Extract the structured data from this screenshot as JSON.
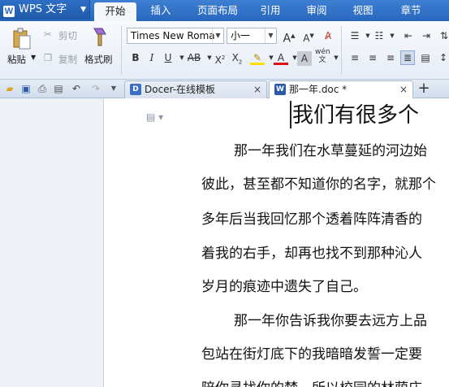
{
  "app": {
    "name": "WPS 文字",
    "logo_letter": "W"
  },
  "menu": [
    "开始",
    "插入",
    "页面布局",
    "引用",
    "审阅",
    "视图",
    "章节"
  ],
  "ribbon": {
    "paste": "粘贴",
    "cut": "剪切",
    "copy": "复制",
    "format_painter": "格式刷",
    "font_name": "Times New Roma",
    "font_size": "小一"
  },
  "tabs": [
    {
      "label": "Docer-在线模板",
      "close": "×"
    },
    {
      "label": "那一年.doc *",
      "close": "×"
    }
  ],
  "new_tab": "+",
  "document": {
    "title": "我们有很多个",
    "lines": [
      "那一年我们在水草蔓延的河边始",
      "彼此，甚至都不知道你的名字，就那个",
      "多年后当我回忆那个透着阵阵清香的",
      "着我的右手，却再也找不到那种沁人",
      "岁月的痕迹中遗失了自己。",
      "那一年你告诉我你要去远方上品",
      "包站在街灯底下的我暗暗发誓一定要",
      "陪你寻找你的梦，所以校园的林荫庄"
    ]
  }
}
